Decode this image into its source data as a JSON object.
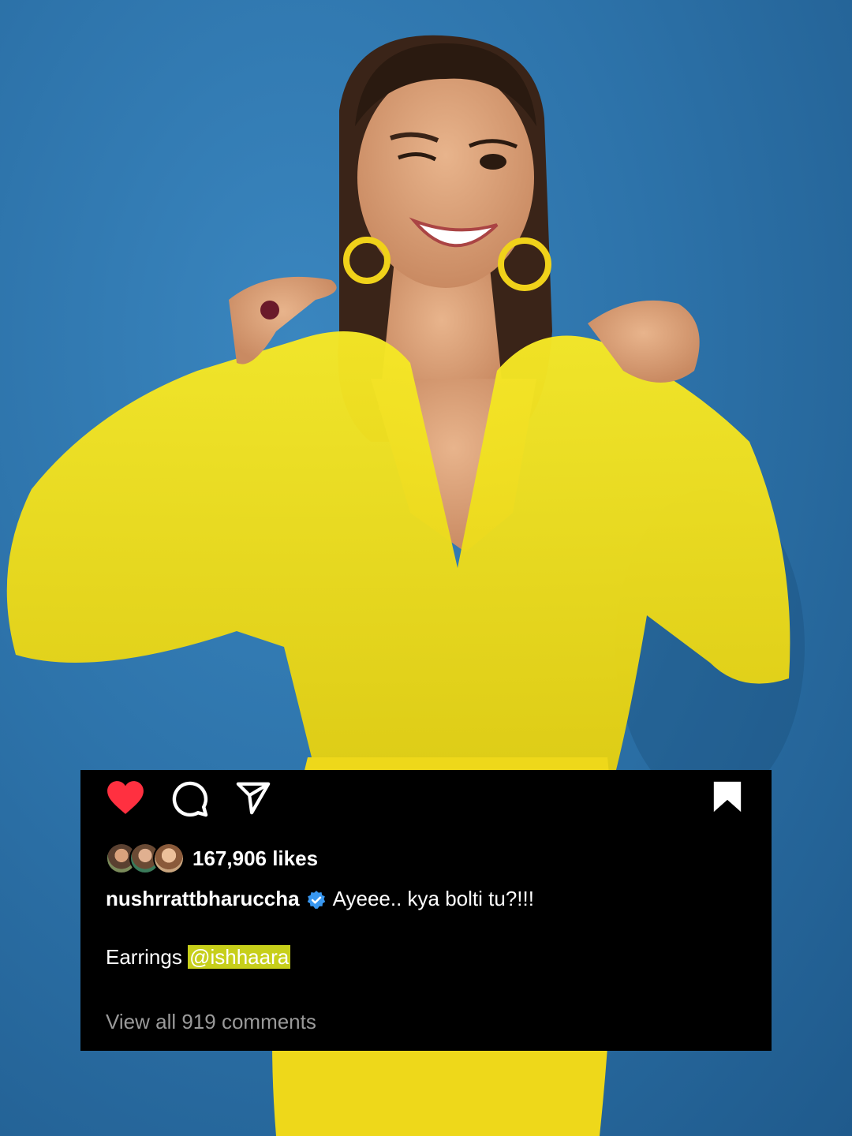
{
  "post": {
    "likes": "167,906 likes",
    "username": "nushrrattbharuccha",
    "caption": "Ayeee.. kya bolti tu?!!!",
    "earrings_label": "Earrings",
    "mention": "@ishhaara",
    "view_comments": "View all 919 comments"
  },
  "icons": {
    "like": "heart-icon",
    "comment": "comment-icon",
    "share": "share-icon",
    "save": "bookmark-icon",
    "verified": "verified-badge-icon"
  },
  "colors": {
    "background": "#2d73aa",
    "card": "#000000",
    "heart": "#ff3040",
    "verified": "#3897f0",
    "mention_highlight": "#c7cf1a",
    "muted_text": "#9a9a9a",
    "outfit": "#f2e21a"
  }
}
